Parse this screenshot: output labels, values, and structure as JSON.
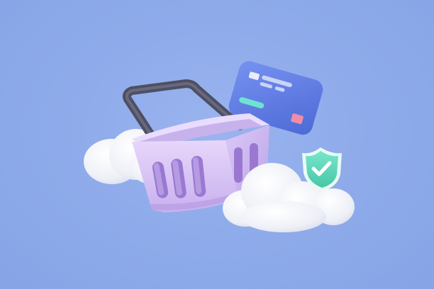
{
  "scene": {
    "colors": {
      "background": "#8fabea",
      "basket": "#d7c3f3",
      "basket_handle": "#5d5f72",
      "card": "#5b78e0",
      "card_chip": "#e9edf9",
      "card_accent_stripe": "#6fe3d2",
      "card_pink_square": "#f08ca5",
      "shield": "#5fd8b9",
      "checkmark": "#ffffff",
      "cloud": "#f3f3f8"
    },
    "icons": [
      "shopping-basket-icon",
      "credit-card-icon",
      "shield-check-icon",
      "cloud-icon"
    ]
  }
}
